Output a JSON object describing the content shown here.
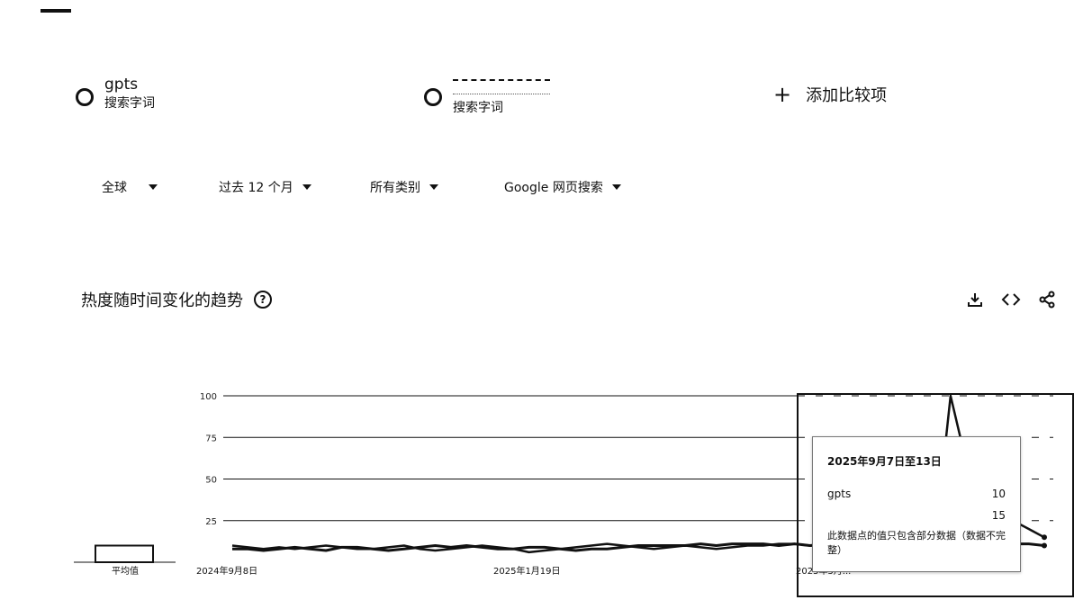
{
  "terms": [
    {
      "name": "gpts",
      "kind": "搜索字词"
    },
    {
      "name": "",
      "kind": "搜索字词"
    }
  ],
  "add_compare": "添加比较项",
  "filters": {
    "region": "全球",
    "time": "过去 12 个月",
    "category": "所有类别",
    "source": "Google 网页搜索"
  },
  "section": {
    "title": "热度随时间变化的趋势",
    "help_icon": "help-circle-icon"
  },
  "actions": [
    "download-icon",
    "embed-code-icon",
    "share-icon"
  ],
  "average_label": "平均值",
  "tooltip": {
    "title": "2025年9月7日至13日",
    "rows": [
      {
        "term": "gpts",
        "value": "10"
      },
      {
        "term": "",
        "value": "15"
      }
    ],
    "note": "此数据点的值只包含部分数据（数据不完整）"
  },
  "chart_data": {
    "type": "line",
    "ylim": [
      0,
      100
    ],
    "yticks": [
      "100",
      "75",
      "50",
      "25"
    ],
    "xtick_labels": [
      "2024年9月8日",
      "2025年1月19日",
      "2025年5月..."
    ],
    "averages": [
      10,
      10
    ],
    "series": [
      {
        "name": "gpts",
        "values": [
          8,
          8,
          7,
          8,
          9,
          8,
          7,
          9,
          9,
          8,
          7,
          8,
          9,
          10,
          9,
          10,
          9,
          8,
          8,
          9,
          9,
          8,
          7,
          8,
          8,
          9,
          10,
          10,
          10,
          10,
          11,
          10,
          11,
          11,
          11,
          10,
          11,
          10,
          11,
          11,
          10,
          11,
          11,
          12,
          12,
          12,
          12,
          11,
          11,
          10,
          11,
          11,
          10
        ]
      },
      {
        "name": "",
        "values": [
          10,
          9,
          8,
          9,
          8,
          9,
          10,
          9,
          8,
          8,
          9,
          10,
          8,
          7,
          8,
          9,
          10,
          9,
          8,
          6,
          7,
          8,
          9,
          10,
          11,
          10,
          9,
          8,
          9,
          10,
          9,
          8,
          9,
          10,
          10,
          11,
          11,
          10,
          10,
          9,
          10,
          10,
          11,
          11,
          12,
          13,
          100,
          60,
          40,
          30,
          25,
          20,
          15
        ]
      }
    ]
  }
}
